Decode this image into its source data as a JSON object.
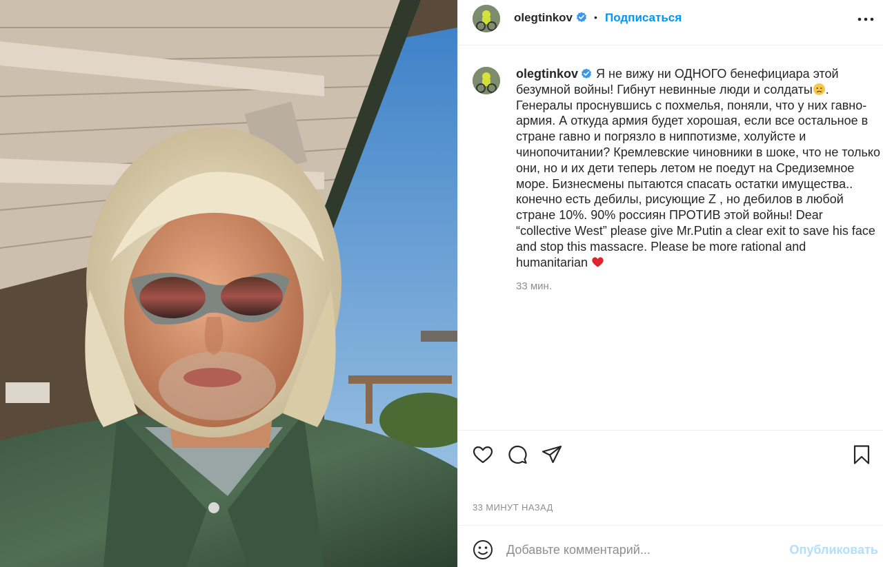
{
  "post": {
    "author": {
      "username": "olegtinkov",
      "verified": true
    },
    "header": {
      "separator": "•",
      "follow_label": "Подписаться"
    },
    "caption": {
      "text_part1": "Я не вижу ни ОДНОГО бенефициара этой безумной войны! Гибнут невинные люди и солдаты",
      "emoji1": "crying-face-emoji",
      "text_part2": ". Генералы проснувшись с похмелья, поняли, что у них гавно-армия. А откуда армия будет хорошая, если все остальное в стране гавно и погрязло в ниппотизме, холуйсте и чинопочитании? Кремлевские чиновники в шоке, что не только они, но и их дети теперь летом не поедут на Средиземное море. Бизнесмены пытаются спасать остатки имущества.. конечно есть дебилы, рисующие Z , но дебилов в любой стране 10%. 90% россиян ПРОТИВ этой войны! Dear “collective West” please give Mr.Putin a clear exit to save his face and stop this massacre. Please be more rational and humanitarian ",
      "emoji2": "red-heart-emoji",
      "relative_time": "33 мин."
    },
    "timestamp": "33 МИНУТ НАЗАД",
    "comment": {
      "placeholder": "Добавьте комментарий...",
      "value": "",
      "publish_label": "Опубликовать"
    },
    "icons": {
      "like": "heart-icon",
      "comment": "comment-icon",
      "share": "send-icon",
      "save": "bookmark-icon",
      "more": "more-horizontal-icon",
      "emoji": "smiley-icon"
    },
    "colors": {
      "link_blue": "#0095f6",
      "publish_disabled": "#b2dffc",
      "verified_blue": "#3897f0",
      "secondary_text": "#8e8e8e"
    }
  }
}
